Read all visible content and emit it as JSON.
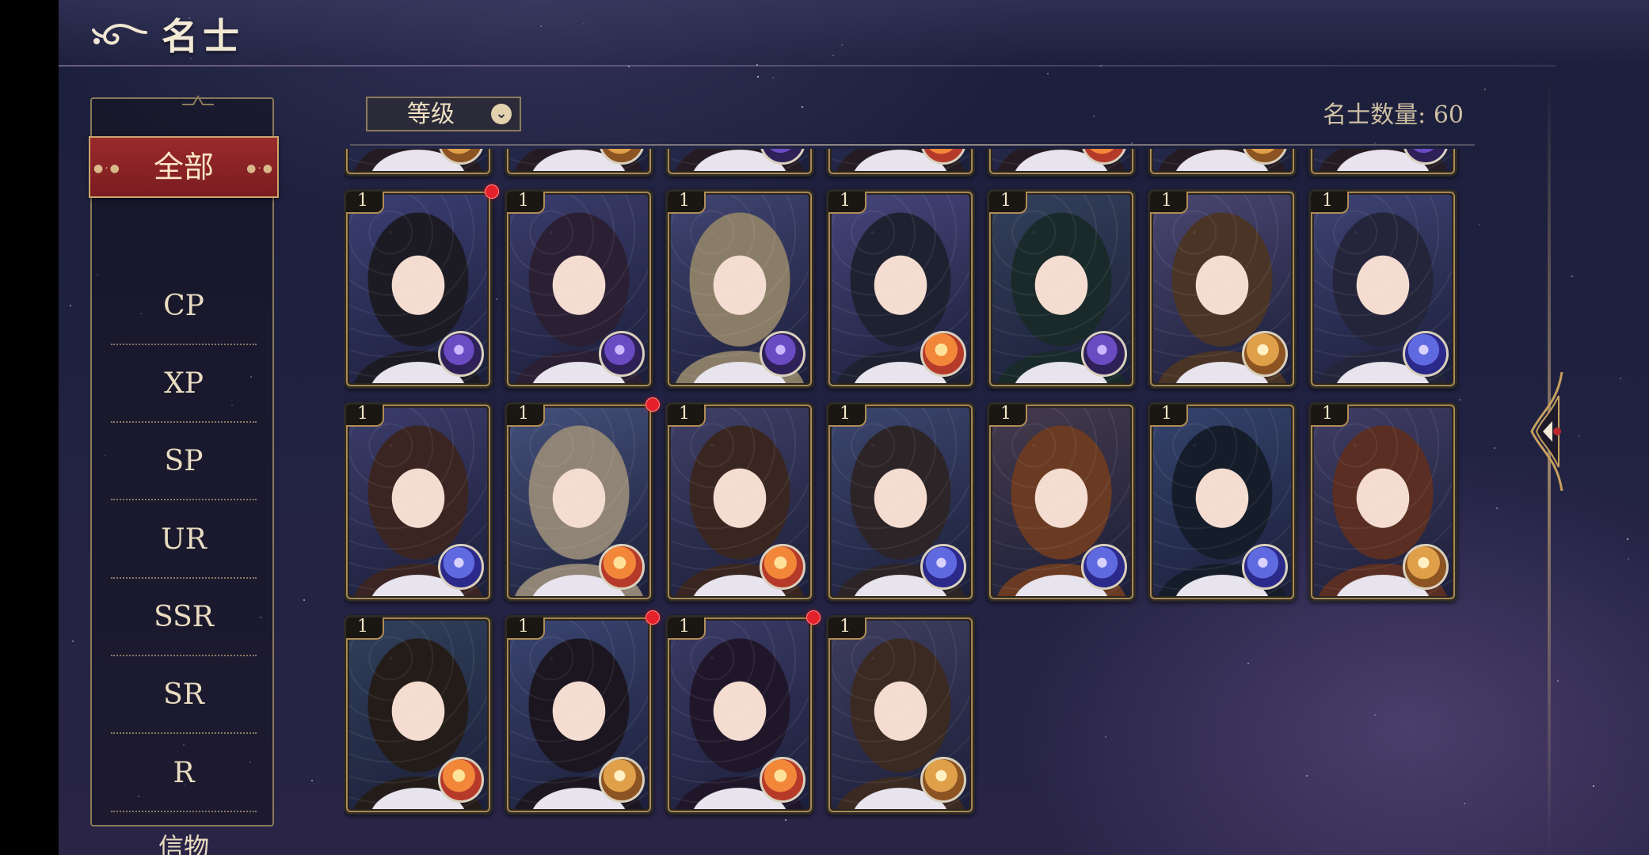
{
  "header": {
    "title": "名士"
  },
  "sidebar": {
    "active": "全部",
    "items": [
      "全部",
      "CP",
      "XP",
      "SP",
      "UR",
      "SSR",
      "SR",
      "R",
      "信物"
    ]
  },
  "toolbar": {
    "sort_label": "等级",
    "count_label": "名士数量:",
    "count_value": "60"
  },
  "cards": [
    {
      "level": "1",
      "attr": "moon",
      "bg": "#3b3f73",
      "hair": "#1c1a22",
      "badge": true
    },
    {
      "level": "1",
      "attr": "moon",
      "bg": "#3a3c6b",
      "hair": "#2b1f33",
      "badge": false
    },
    {
      "level": "1",
      "attr": "moon",
      "bg": "#404471",
      "hair": "#8a7d68",
      "badge": false
    },
    {
      "level": "1",
      "attr": "sun",
      "bg": "#45457a",
      "hair": "#1e2130",
      "badge": false
    },
    {
      "level": "1",
      "attr": "moon",
      "bg": "#33405a",
      "hair": "#1a2a2a",
      "badge": false
    },
    {
      "level": "1",
      "attr": "sun_gold",
      "bg": "#4a4670",
      "hair": "#4a3426",
      "badge": false
    },
    {
      "level": "1",
      "attr": "planet",
      "bg": "#3d4272",
      "hair": "#24253a",
      "badge": false
    },
    {
      "level": "1",
      "attr": "planet",
      "bg": "#3b3c6a",
      "hair": "#3a2522",
      "badge": false
    },
    {
      "level": "1",
      "attr": "sun",
      "bg": "#44507a",
      "hair": "#8f8475",
      "badge": true
    },
    {
      "level": "1",
      "attr": "sun",
      "bg": "#3f3f66",
      "hair": "#3a2620",
      "badge": false
    },
    {
      "level": "1",
      "attr": "planet",
      "bg": "#3c466e",
      "hair": "#2c2426",
      "badge": false
    },
    {
      "level": "1",
      "attr": "planet",
      "bg": "#443a4c",
      "hair": "#6a3a22",
      "badge": false
    },
    {
      "level": "1",
      "attr": "planet",
      "bg": "#34436c",
      "hair": "#151c2a",
      "badge": false
    },
    {
      "level": "1",
      "attr": "sun_gold",
      "bg": "#3f3d63",
      "hair": "#5a2e22",
      "badge": false
    },
    {
      "level": "1",
      "attr": "sun",
      "bg": "#30405a",
      "hair": "#241c18",
      "badge": false
    },
    {
      "level": "1",
      "attr": "sun_gold",
      "bg": "#3a4470",
      "hair": "#1b1620",
      "badge": true
    },
    {
      "level": "1",
      "attr": "sun",
      "bg": "#3a3a66",
      "hair": "#20162a",
      "badge": true
    },
    {
      "level": "1",
      "attr": "sun_gold",
      "bg": "#3e3d5e",
      "hair": "#3a2a22",
      "badge": false
    }
  ],
  "partial_row": [
    {
      "attr": "sun_gold"
    },
    {
      "attr": "sun_gold"
    },
    {
      "attr": "moon"
    },
    {
      "attr": "sun"
    },
    {
      "attr": "sun"
    },
    {
      "attr": "sun_gold"
    },
    {
      "attr": "moon"
    }
  ],
  "colors": {
    "accent_red": "#8a2225",
    "gold": "#c7a05d",
    "badge_red": "#e5222b"
  },
  "icons": {
    "back": "cloud-swirl-back-icon",
    "sort": "chevron-down-icon",
    "collapse": "left-arrow-icon"
  }
}
